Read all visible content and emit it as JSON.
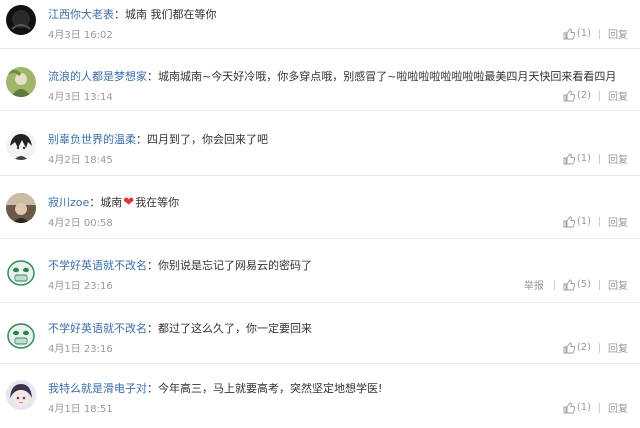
{
  "comments": [
    {
      "user": "江西你大老表",
      "colon": "：",
      "text": "城南 我们都在等你",
      "time": "4月3日 16:02",
      "likes": "(1)",
      "reply": "回复",
      "avatar": "dark"
    },
    {
      "user": "流浪的人都是梦想家",
      "colon": "：",
      "text": "城南城南~今天好冷哦，你多穿点哦，别感冒了~啦啦啦啦啦啦啦啦最美四月天快回来看看四月",
      "time": "4月3日 13:14",
      "likes": "(2)",
      "reply": "回复",
      "avatar": "green"
    },
    {
      "user": "别辜负世界的温柔",
      "colon": "：",
      "text": "四月到了，你会回来了吧",
      "time": "4月2日 18:45",
      "likes": "(1)",
      "reply": "回复",
      "avatar": "anime"
    },
    {
      "user": "寂川zoe",
      "colon": "：",
      "text": "城南",
      "text2": "我在等你",
      "heart": "❤",
      "time": "4月2日 00:58",
      "likes": "(1)",
      "reply": "回复",
      "avatar": "photo"
    },
    {
      "user": "不学好英语就不改名",
      "colon": "：",
      "text": "你别说是忘记了网易云的密码了",
      "time": "4月1日 23:16",
      "report": "举报",
      "likes": "(5)",
      "reply": "回复",
      "avatar": "face"
    },
    {
      "user": "不学好英语就不改名",
      "colon": "：",
      "text": "都过了这么久了，你一定要回来",
      "time": "4月1日 23:16",
      "likes": "(2)",
      "reply": "回复",
      "avatar": "face"
    },
    {
      "user": "我特么就是滑电子对",
      "colon": "：",
      "text": "今年高三，马上就要高考，突然坚定地想学医!",
      "time": "4月1日 18:51",
      "likes": "(1)",
      "reply": "回复",
      "avatar": "girl"
    }
  ]
}
